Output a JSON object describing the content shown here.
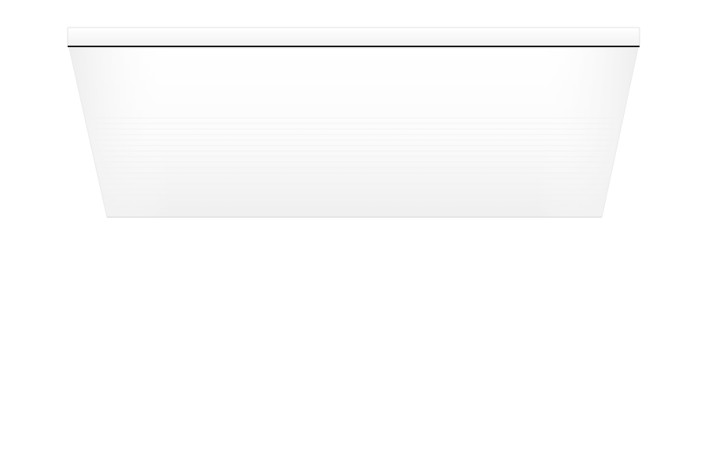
{
  "scene": {
    "subject": "ceiling-light-panel",
    "colors": {
      "background": "#ffffff",
      "trim_top": "#f9f9f9",
      "trim_face": "#f3f3f3",
      "edge_line": "#1a1a1a",
      "diffuser_light": "#fdfdfd",
      "diffuser_shade": "#efefef",
      "bottom_edge": "#e4e4e4"
    }
  }
}
